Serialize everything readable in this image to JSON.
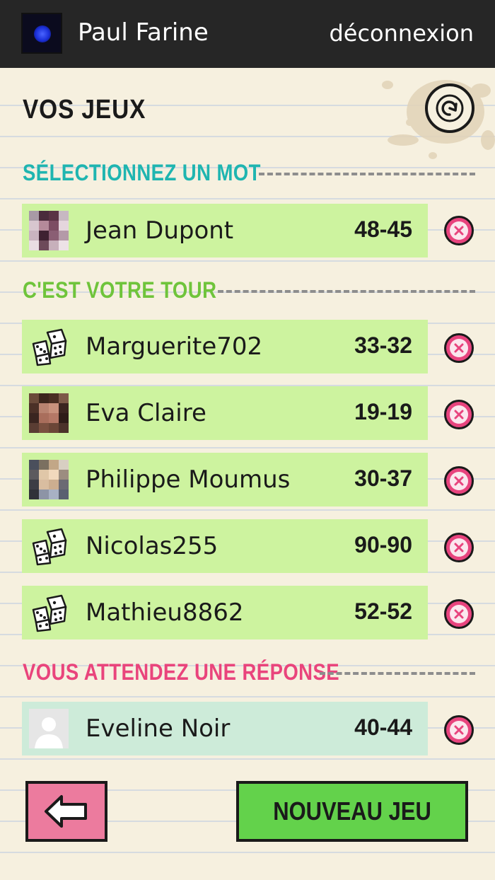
{
  "header": {
    "username": "Paul Farine",
    "logout_label": "déconnexion"
  },
  "page": {
    "title": "VOS JEUX"
  },
  "sections": {
    "select_word": {
      "title": "SÉLECTIONNEZ UN MOT",
      "color": "#1fb5b0",
      "games": [
        {
          "player": "Jean Dupont",
          "score": "48-45",
          "avatar": "photo"
        }
      ]
    },
    "your_turn": {
      "title": "C'EST VOTRE TOUR",
      "color": "#6fc43b",
      "games": [
        {
          "player": "Marguerite702",
          "score": "33-32",
          "avatar": "dice"
        },
        {
          "player": "Eva Claire",
          "score": "19-19",
          "avatar": "photo"
        },
        {
          "player": "Philippe Moumus",
          "score": "30-37",
          "avatar": "photo"
        },
        {
          "player": "Nicolas255",
          "score": "90-90",
          "avatar": "dice"
        },
        {
          "player": "Mathieu8862",
          "score": "52-52",
          "avatar": "dice"
        }
      ]
    },
    "waiting": {
      "title": "VOUS ATTENDEZ UNE RÉPONSE",
      "color": "#e9447c",
      "games": [
        {
          "player": "Eveline Noir",
          "score": "40-44",
          "avatar": "default"
        }
      ]
    }
  },
  "footer": {
    "new_game_label": "NOUVEAU JEU"
  },
  "colors": {
    "topbar": "#262626",
    "row_active": "#cdf39f",
    "row_waiting": "#cdebd9",
    "delete": "#e8447e",
    "back_button": "#ec7b9e",
    "new_game_button": "#63d24b"
  },
  "icons": {
    "refresh": "refresh-icon",
    "delete": "close-icon",
    "back": "arrow-left-icon",
    "dice": "dice-icon"
  }
}
